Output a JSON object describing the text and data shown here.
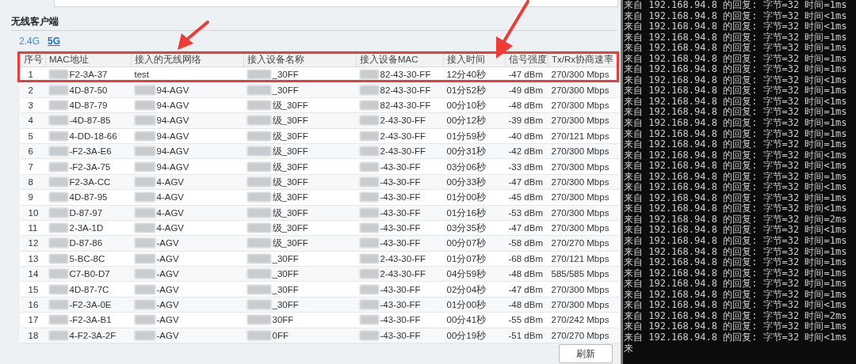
{
  "section_title": "无线客户端",
  "bands": [
    {
      "label": "2.4G",
      "selected": false
    },
    {
      "label": "5G",
      "selected": true
    }
  ],
  "table": {
    "columns": [
      "序号",
      "MAC地址",
      "接入的无线网络",
      "接入设备名称",
      "接入设备MAC",
      "接入时间",
      "信号强度",
      "Tx/Rx协商速率"
    ],
    "rows": [
      [
        "1",
        "F2-3A-37",
        "test",
        "_30FF",
        "82-43-30-FF",
        "12分40秒",
        "-47 dBm",
        "270/300 Mbps"
      ],
      [
        "2",
        "4D-87-50",
        "94-AGV",
        "_30FF",
        "82-43-30-FF",
        "01分52秒",
        "-49 dBm",
        "270/300 Mbps"
      ],
      [
        "3",
        "4D-87-79",
        "94-AGV",
        "级_30FF",
        "82-43-30-FF",
        "00分10秒",
        "-48 dBm",
        "270/300 Mbps"
      ],
      [
        "4",
        "-4D-87-85",
        "94-AGV",
        "级_30FF",
        "2-43-30-FF",
        "00分12秒",
        "-39 dBm",
        "270/300 Mbps"
      ],
      [
        "5",
        "4-DD-18-66",
        "94-AGV",
        "级_30FF",
        "2-43-30-FF",
        "01分59秒",
        "-40 dBm",
        "270/121 Mbps"
      ],
      [
        "6",
        "-F2-3A-E6",
        "94-AGV",
        "级_30FF",
        "2-43-30-FF",
        "00分31秒",
        "-42 dBm",
        "270/300 Mbps"
      ],
      [
        "7",
        "-F2-3A-75",
        "94-AGV",
        "级_30FF",
        "-43-30-FF",
        "03分06秒",
        "-33 dBm",
        "270/300 Mbps"
      ],
      [
        "8",
        "F2-3A-CC",
        "4-AGV",
        "级_30FF",
        "-43-30-FF",
        "00分33秒",
        "-47 dBm",
        "270/300 Mbps"
      ],
      [
        "9",
        "4D-87-95",
        "4-AGV",
        "级_30FF",
        "-43-30-FF",
        "01分00秒",
        "-45 dBm",
        "270/300 Mbps"
      ],
      [
        "10",
        "D-87-97",
        "4-AGV",
        "级_30FF",
        "-43-30-FF",
        "01分16秒",
        "-53 dBm",
        "270/300 Mbps"
      ],
      [
        "11",
        "2-3A-1D",
        "4-AGV",
        "级_30FF",
        "-43-30-FF",
        "03分35秒",
        "-47 dBm",
        "270/300 Mbps"
      ],
      [
        "12",
        "D-87-86",
        "-AGV",
        "级_30FF",
        "-43-30-FF",
        "00分07秒",
        "-58 dBm",
        "270/270 Mbps"
      ],
      [
        "13",
        "5-BC-8C",
        "-AGV",
        "_30FF",
        "2-43-30-FF",
        "01分07秒",
        "-68 dBm",
        "270/121 Mbps"
      ],
      [
        "14",
        "C7-B0-D7",
        "-AGV",
        "_30FF",
        "2-43-30-FF",
        "04分59秒",
        "-48 dBm",
        "585/585 Mbps"
      ],
      [
        "15",
        "4D-87-7C",
        "-AGV",
        "_30FF",
        "-43-30-FF",
        "02分04秒",
        "-47 dBm",
        "270/300 Mbps"
      ],
      [
        "16",
        "-F2-3A-0E",
        "-AGV",
        "_30FF",
        "-43-30-FF",
        "01分00秒",
        "-48 dBm",
        "270/300 Mbps"
      ],
      [
        "17",
        "-F2-3A-B1",
        "-AGV",
        "30FF",
        "-43-30-FF",
        "00分41秒",
        "-55 dBm",
        "270/242 Mbps"
      ],
      [
        "18",
        "4-F2-3A-2F",
        "-AGV",
        "0FF",
        "-43-30-FF",
        "00分19秒",
        "-51 dBm",
        "270/270 Mbps"
      ]
    ]
  },
  "refresh_button": "刷新",
  "terminal_lines": [
    "来自 192.168.94.8 的回复: 字节=32 时间=1ms",
    "来自 192.168.94.8 的回复: 字节=32 时间<1ms",
    "来自 192.168.94.8 的回复: 字节=32 时间<1ms",
    "来自 192.168.94.8 的回复: 字节=32 时间=1ms",
    "来自 192.168.94.8 的回复: 字节=32 时间=1ms",
    "来自 192.168.94.8 的回复: 字节=32 时间=1ms",
    "来自 192.168.94.8 的回复: 字节=32 时间=1ms",
    "来自 192.168.94.8 的回复: 字节=32 时间<1ms",
    "来自 192.168.94.8 的回复: 字节=32 时间=1ms",
    "来自 192.168.94.8 的回复: 字节=32 时间<1ms",
    "来自 192.168.94.8 的回复: 字节=32 时间=1ms",
    "来自 192.168.94.8 的回复: 字节=32 时间=1ms",
    "来自 192.168.94.8 的回复: 字节=32 时间=1ms",
    "来自 192.168.94.8 的回复: 字节=32 时间=1ms",
    "来自 192.168.94.8 的回复: 字节=32 时间<1ms",
    "来自 192.168.94.8 的回复: 字节=32 时间<1ms",
    "来自 192.168.94.8 的回复: 字节=32 时间=1ms",
    "来自 192.168.94.8 的回复: 字节=32 时间<1ms",
    "来自 192.168.94.8 的回复: 字节=32 时间=1ms",
    "来自 192.168.94.8 的回复: 字节=32 时间<1ms",
    "来自 192.168.94.8 的回复: 字节=32 时间=2ms",
    "来自 192.168.94.8 的回复: 字节=32 时间<1ms",
    "来自 192.168.94.8 的回复: 字节=32 时间=1ms",
    "来自 192.168.94.8 的回复: 字节=32 时间=1ms",
    "来自 192.168.94.8 的回复: 字节=32 时间=1ms",
    "来自 192.168.94.8 的回复: 字节=32 时间=1ms",
    "来自 192.168.94.8 的回复: 字节=32 时间=1ms",
    "来自 192.168.94.8 的回复: 字节=32 时间=1ms",
    "来自 192.168.94.8 的回复: 字节=32 时间<1ms",
    "来自 192.168.94.8 的回复: 字节=32 时间=2ms",
    "来自 192.168.94.8 的回复: 字节=32 时间=1ms",
    "来自 192.168.94.8 的回复: 字节=32 时间<1ms",
    "来"
  ]
}
